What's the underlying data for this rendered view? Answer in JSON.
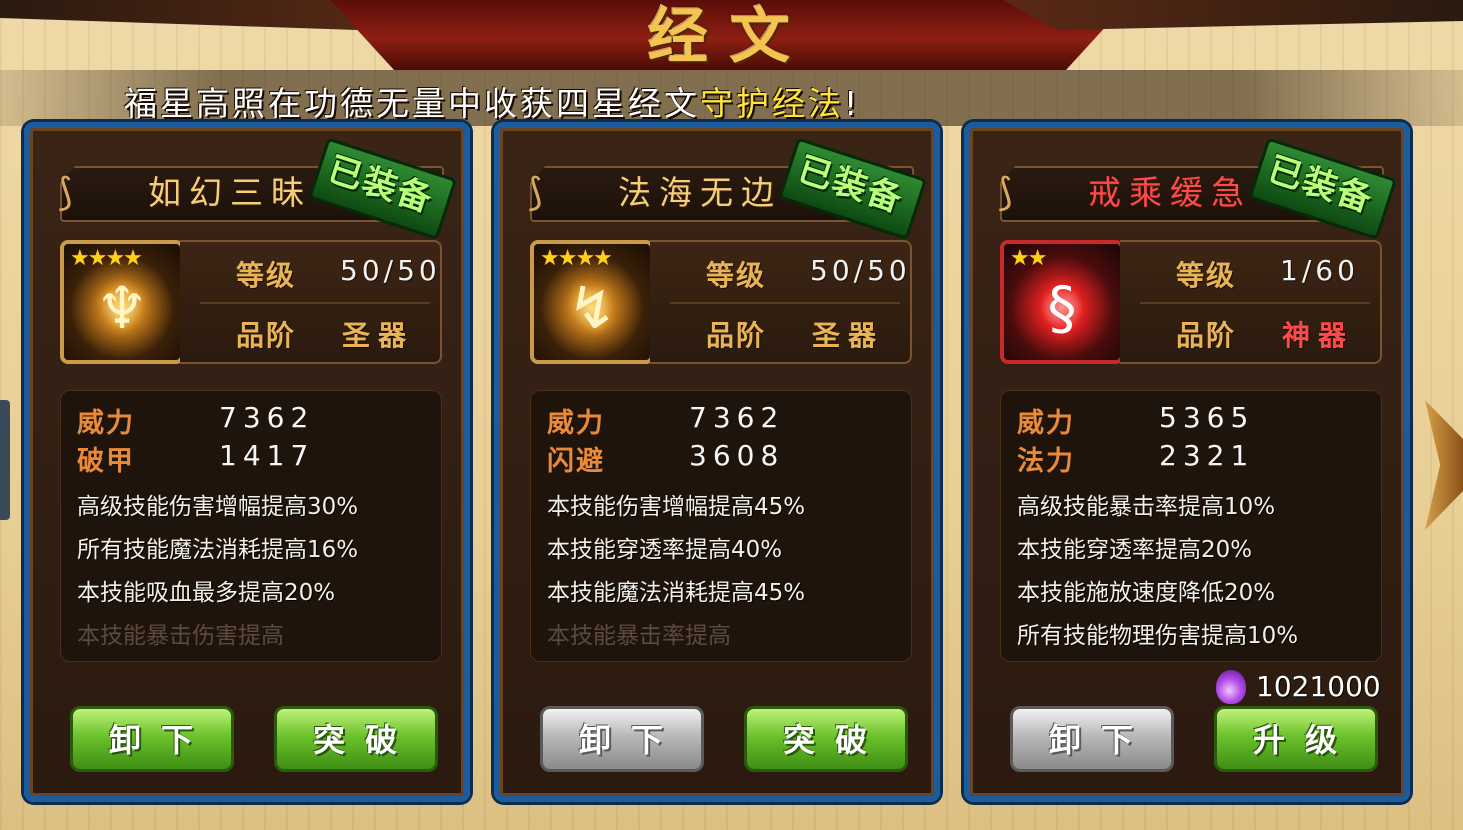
{
  "header": {
    "title": "经文",
    "notice_prefix": "福星高照在功德无量中收获四星经文",
    "notice_highlight": "守护经法",
    "notice_suffix": "!"
  },
  "colors": {
    "card_border": "#1c5c9c",
    "green_button": "#6cc22c",
    "gray_button": "#b8b8b8",
    "label_gold": "#e8b456",
    "stat_orange": "#e88a3a",
    "red_quality": "#ff4a4a"
  },
  "cards": [
    {
      "name": "如幻三昧",
      "badge": "已装备",
      "stars": "★★★★",
      "level_label": "等级",
      "level": "50/50",
      "quality_label": "品阶",
      "quality": "圣器",
      "icon": "trident-glow-icon",
      "stats": [
        {
          "label": "威力",
          "value": "7362"
        },
        {
          "label": "破甲",
          "value": "1417"
        }
      ],
      "effects": [
        "高级技能伤害增幅提高30%",
        "所有技能魔法消耗提高16%",
        "本技能吸血最多提高20%"
      ],
      "locked_effect": "本技能暴击伤害提高",
      "btn_left": "卸下",
      "btn_right": "突破"
    },
    {
      "name": "法海无边",
      "badge": "已装备",
      "stars": "★★★★",
      "level_label": "等级",
      "level": "50/50",
      "quality_label": "品阶",
      "quality": "圣器",
      "icon": "blade-glow-icon",
      "stats": [
        {
          "label": "威力",
          "value": "7362"
        },
        {
          "label": "闪避",
          "value": "3608"
        }
      ],
      "effects": [
        "本技能伤害增幅提高45%",
        "本技能穿透率提高40%",
        "本技能魔法消耗提高45%"
      ],
      "locked_effect": "本技能暴击率提高",
      "btn_left": "卸下",
      "btn_right": "突破"
    },
    {
      "name": "戒乘缓急",
      "badge": "已装备",
      "stars": "★★",
      "level_label": "等级",
      "level": "1/60",
      "quality_label": "品阶",
      "quality": "神器",
      "icon": "red-swirl-icon",
      "stats": [
        {
          "label": "威力",
          "value": "5365"
        },
        {
          "label": "法力",
          "value": "2321"
        }
      ],
      "effects": [
        "高级技能暴击率提高10%",
        "本技能穿透率提高20%",
        "本技能施放速度降低20%",
        "所有技能物理伤害提高10%"
      ],
      "cost": "1021000",
      "btn_left": "卸下",
      "btn_right": "升级"
    }
  ]
}
